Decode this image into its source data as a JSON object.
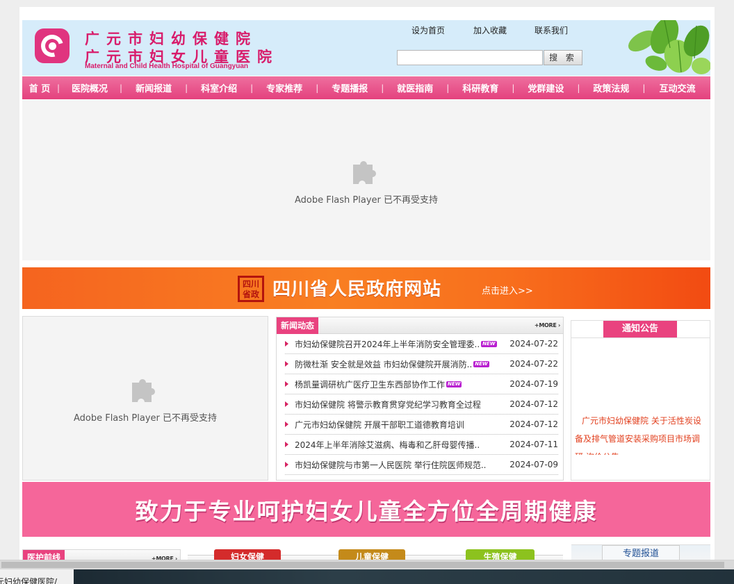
{
  "stray_text": "-->",
  "header": {
    "logo_cn_line1": "广元市妇幼保健院",
    "logo_cn_line2": "广元市妇女儿童医院",
    "logo_en": "Maternal and Child Health Hospital of Guangyuan",
    "top_links": [
      "设为首页",
      "加入收藏",
      "联系我们"
    ],
    "search_placeholder": "",
    "search_button": "搜 索"
  },
  "nav": {
    "items": [
      "首 页",
      "医院概况",
      "新闻报道",
      "科室介绍",
      "专家推荐",
      "专题播报",
      "就医指南",
      "科研教育",
      "党群建设",
      "政策法规",
      "互动交流"
    ],
    "separator": "|"
  },
  "flash": {
    "message": "Adobe Flash Player 已不再受支持"
  },
  "gov_banner": {
    "seal_text": "四川省政",
    "title": "四川省人民政府网站",
    "link": "点击进入>>"
  },
  "news": {
    "tab": "新闻动态",
    "more": "+MORE ›",
    "new_badge": "NEW",
    "items": [
      {
        "title": "市妇幼保健院召开2024年上半年消防安全管理委..",
        "date": "2024-07-22",
        "is_new": true
      },
      {
        "title": "防微杜渐 安全就是效益 市妇幼保健院开展消防..",
        "date": "2024-07-22",
        "is_new": true
      },
      {
        "title": "杨凯量调研杭广医疗卫生东西部协作工作",
        "date": "2024-07-19",
        "is_new": true
      },
      {
        "title": "市妇幼保健院 将警示教育贯穿党纪学习教育全过程",
        "date": "2024-07-12",
        "is_new": false
      },
      {
        "title": "广元市妇幼保健院 开展干部职工道德教育培训",
        "date": "2024-07-12",
        "is_new": false
      },
      {
        "title": "2024年上半年消除艾滋病、梅毒和乙肝母婴传播..",
        "date": "2024-07-11",
        "is_new": false
      },
      {
        "title": "市妇幼保健院与市第一人民医院 举行住院医师规范..",
        "date": "2024-07-09",
        "is_new": false
      }
    ]
  },
  "notice": {
    "tab": "通知公告",
    "text": "广元市妇幼保健院 关于活性炭设备及排气管道安装采购项目市场调研 询价公告"
  },
  "slogan": "致力于专业呵护妇女儿童全方位全周期健康",
  "bottom": {
    "frontier_tab": "医护前线",
    "more": "+MORE ›",
    "tabs": [
      {
        "label": "妇女保健",
        "color": "#d42b2b"
      },
      {
        "label": "儿童保健",
        "color": "#c48a1a"
      },
      {
        "label": "生殖保健",
        "color": "#8cc21e"
      }
    ],
    "special_tab": "专题报道"
  },
  "status_text": "元妇幼保健医院/"
}
